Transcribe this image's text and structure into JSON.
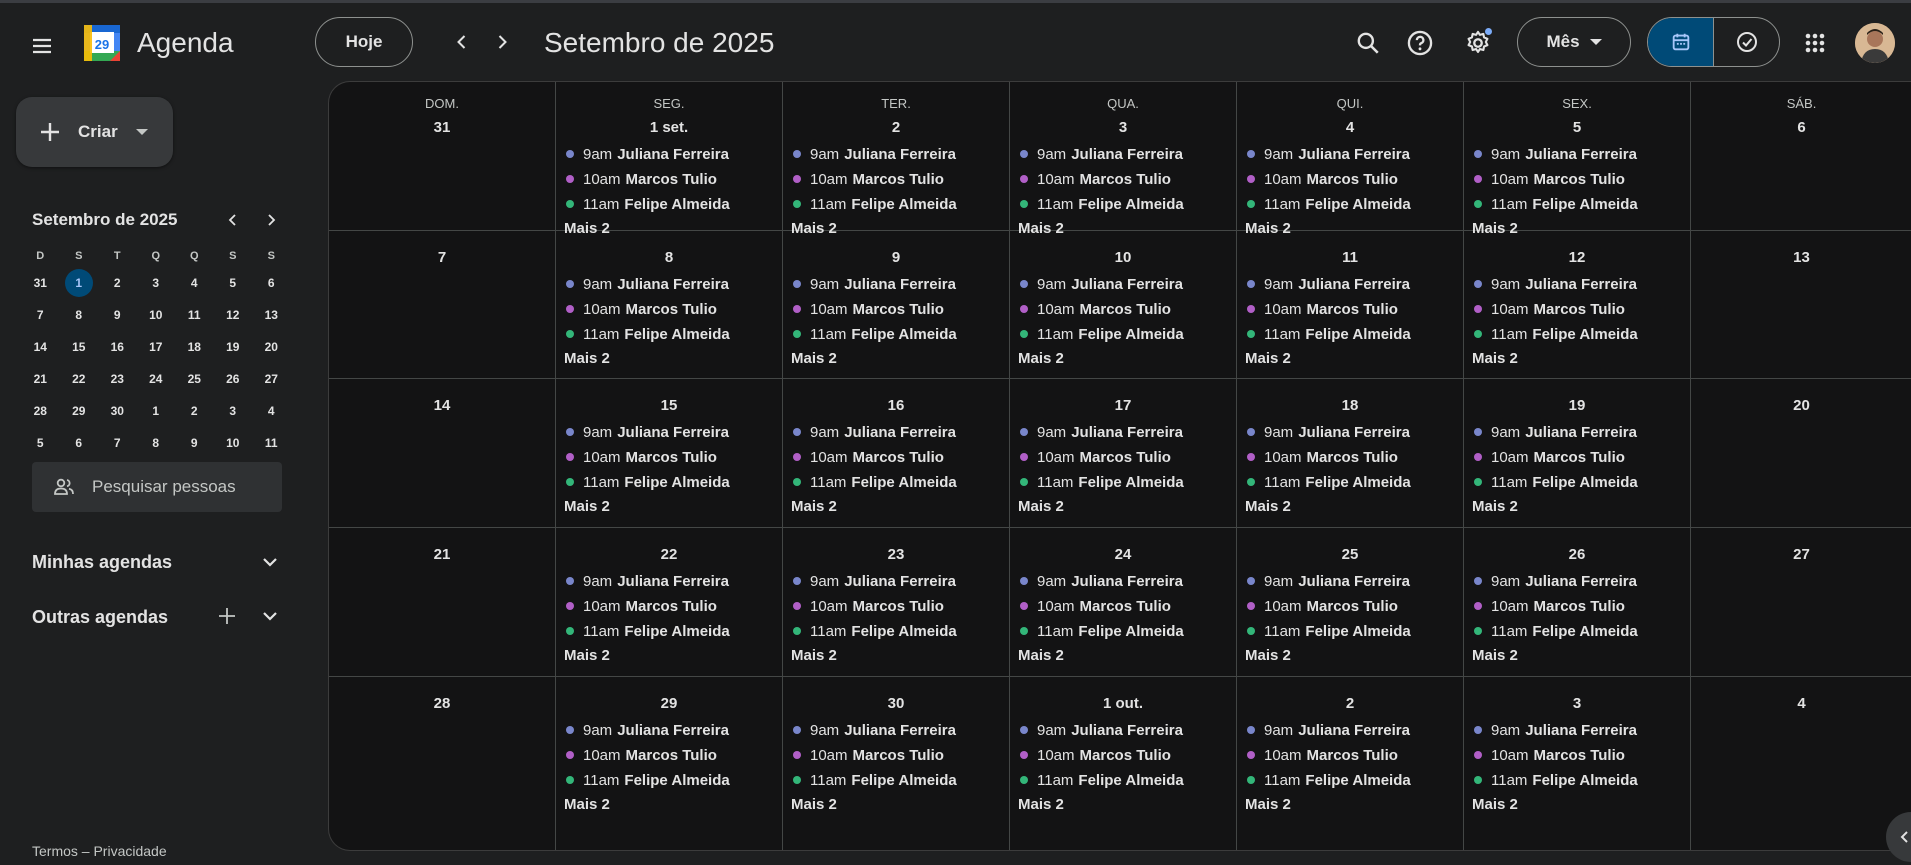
{
  "app": {
    "name": "Agenda",
    "logo_day": "29"
  },
  "header": {
    "today_label": "Hoje",
    "period_title": "Setembro de 2025",
    "view_label": "Mês",
    "colors": {
      "accent": "#004a77",
      "accent_text": "#a8c7fa",
      "notify_dot": "#7cacf8"
    }
  },
  "sidebar": {
    "create_label": "Criar",
    "mini_cal": {
      "title": "Setembro de 2025",
      "headers": [
        "D",
        "S",
        "T",
        "Q",
        "Q",
        "S",
        "S"
      ],
      "days": [
        "31",
        "1",
        "2",
        "3",
        "4",
        "5",
        "6",
        "7",
        "8",
        "9",
        "10",
        "11",
        "12",
        "13",
        "14",
        "15",
        "16",
        "17",
        "18",
        "19",
        "20",
        "21",
        "22",
        "23",
        "24",
        "25",
        "26",
        "27",
        "28",
        "29",
        "30",
        "1",
        "2",
        "3",
        "4",
        "5",
        "6",
        "7",
        "8",
        "9",
        "10",
        "11"
      ],
      "selected": "1"
    },
    "search_people_label": "Pesquisar pessoas",
    "my_calendars_label": "Minhas agendas",
    "other_calendars_label": "Outras agendas",
    "footer": "Termos – Privacidade"
  },
  "calendar": {
    "weekdays": [
      "DOM.",
      "SEG.",
      "TER.",
      "QUA.",
      "QUI.",
      "SEX.",
      "SÁB."
    ],
    "weeks": [
      [
        "31",
        "1 set.",
        "2",
        "3",
        "4",
        "5",
        "6"
      ],
      [
        "7",
        "8",
        "9",
        "10",
        "11",
        "12",
        "13"
      ],
      [
        "14",
        "15",
        "16",
        "17",
        "18",
        "19",
        "20"
      ],
      [
        "21",
        "22",
        "23",
        "24",
        "25",
        "26",
        "27"
      ],
      [
        "28",
        "29",
        "30",
        "1 out.",
        "2",
        "3",
        "4"
      ]
    ],
    "events": [
      {
        "time": "9am",
        "title": "Juliana Ferreira",
        "color": "#7986cb"
      },
      {
        "time": "10am",
        "title": "Marcos Tulio",
        "color": "#b15fc7"
      },
      {
        "time": "11am",
        "title": "Felipe Almeida",
        "color": "#33b679"
      }
    ],
    "more_label": "Mais 2"
  }
}
